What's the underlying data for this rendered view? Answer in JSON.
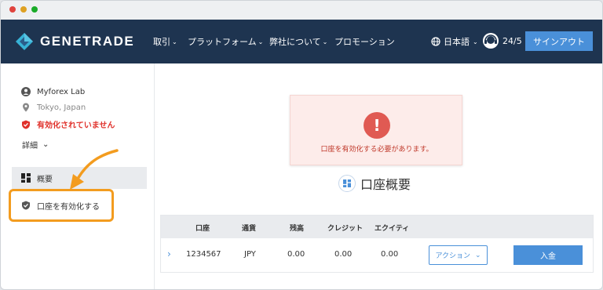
{
  "navbar": {
    "logo_text": "GENETRADE",
    "items": [
      {
        "label": "取引"
      },
      {
        "label": "プラットフォーム"
      },
      {
        "label": "弊社について"
      },
      {
        "label": "プロモーション"
      }
    ],
    "language": "日本語",
    "support_hours": "24/5",
    "signout_label": "サインアウト"
  },
  "sidebar": {
    "user_name": "Myforex Lab",
    "location": "Tokyo, Japan",
    "status_text": "有効化されていません",
    "detail_label": "詳細",
    "menu": {
      "overview_label": "概要",
      "activate_label": "口座を有効化する"
    }
  },
  "alert": {
    "icon": "!",
    "message": "口座を有効化する必要があります。"
  },
  "main": {
    "heading": "口座概要"
  },
  "table": {
    "columns": [
      "口座",
      "通貨",
      "残高",
      "クレジット",
      "エクイティ"
    ],
    "rows": [
      {
        "account": "1234567",
        "currency": "JPY",
        "balance": "0.00",
        "credit": "0.00",
        "equity": "0.00",
        "action_label": "アクション",
        "deposit_label": "入金"
      }
    ]
  },
  "colors": {
    "navbar_bg": "#1e3450",
    "accent": "#4a90d9",
    "alert_red": "#e05a53",
    "highlight_orange": "#f39c1f"
  }
}
